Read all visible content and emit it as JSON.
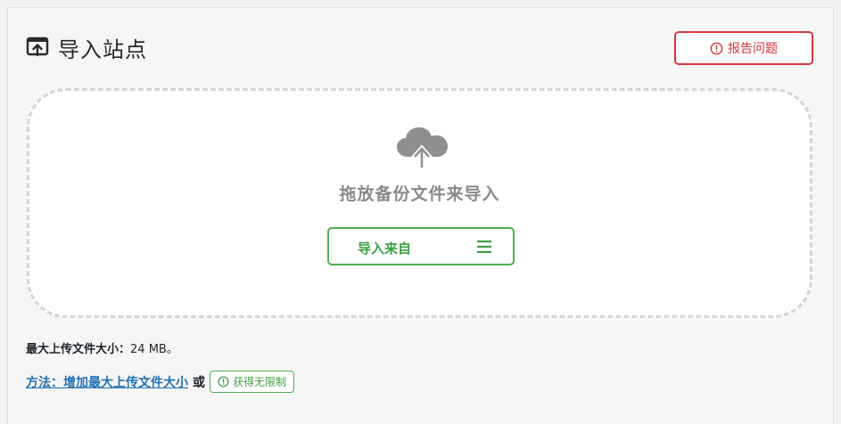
{
  "header": {
    "title": "导入站点",
    "icon": "import-icon"
  },
  "report_button": {
    "label": "报告问题",
    "icon": "alert-circle-icon",
    "color": "#d63638"
  },
  "dropzone": {
    "icon": "cloud-upload-icon",
    "text": "拖放备份文件来导入",
    "import_from_button": {
      "label": "导入来自",
      "icon": "menu-icon",
      "color": "#3f9e44"
    }
  },
  "limits": {
    "max_size_label": "最大上传文件大小：",
    "max_size_value": "24 MB。"
  },
  "help": {
    "howto_link": "方法：增加最大上传文件大小",
    "or_text": "或",
    "unlimited_button": {
      "label": "获得无限制",
      "icon": "alert-circle-icon"
    }
  },
  "colors": {
    "accent_red": "#d63638",
    "accent_green": "#3f9e44",
    "link_blue": "#2271b1"
  }
}
